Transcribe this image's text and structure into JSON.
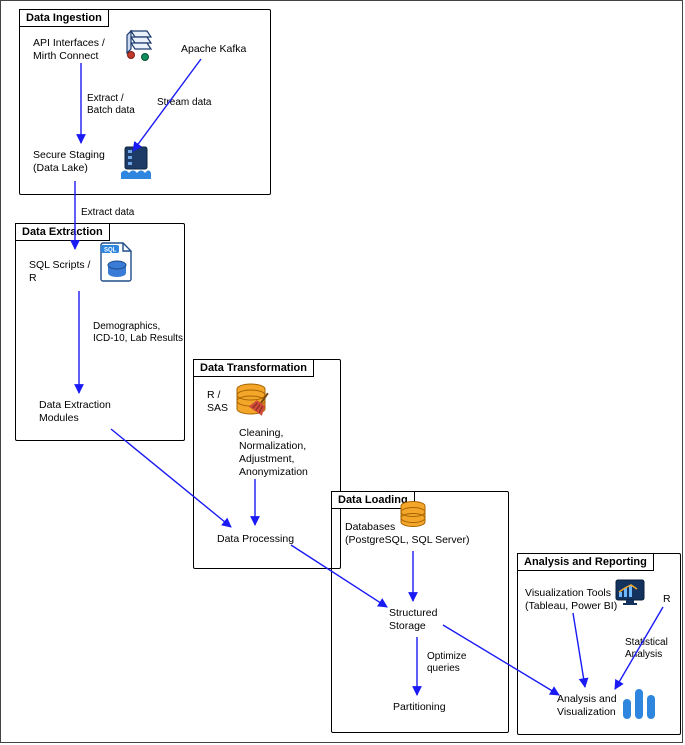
{
  "groups": {
    "ingestion": {
      "title": "Data Ingestion"
    },
    "extraction": {
      "title": "Data Extraction"
    },
    "transformation": {
      "title": "Data Transformation"
    },
    "loading": {
      "title": "Data Loading"
    },
    "analysis": {
      "title": "Analysis and Reporting"
    }
  },
  "nodes": {
    "api": {
      "label": "API Interfaces /\nMirth Connect"
    },
    "kafka": {
      "label": "Apache Kafka"
    },
    "staging": {
      "label": "Secure Staging\n(Data Lake)"
    },
    "sqlscripts": {
      "label": "SQL Scripts /\nR"
    },
    "extmodules": {
      "label": "Data Extraction\nModules"
    },
    "rsas": {
      "label": "R /\nSAS"
    },
    "rsas_sub": {
      "label": "Cleaning,\nNormalization,\nAdjustment,\nAnonymization"
    },
    "processing": {
      "label": "Data Processing"
    },
    "databases": {
      "label": "Databases\n(PostgreSQL, SQL Server)"
    },
    "structured": {
      "label": "Structured\nStorage"
    },
    "partitioning": {
      "label": "Partitioning"
    },
    "viztools": {
      "label": "Visualization Tools\n(Tableau, Power BI)"
    },
    "r2": {
      "label": "R"
    },
    "analysisviz": {
      "label": "Analysis and\nVisualization"
    }
  },
  "edges": {
    "extract_batch": {
      "label": "Extract /\nBatch data"
    },
    "stream": {
      "label": "Stream data"
    },
    "extract_data": {
      "label": "Extract data"
    },
    "demographics": {
      "label": "Demographics,\nICD-10, Lab Results"
    },
    "optimize": {
      "label": "Optimize\nqueries"
    },
    "stat": {
      "label": "Statistical\nAnalysis"
    }
  },
  "colors": {
    "arrow": "#1a1af5"
  }
}
